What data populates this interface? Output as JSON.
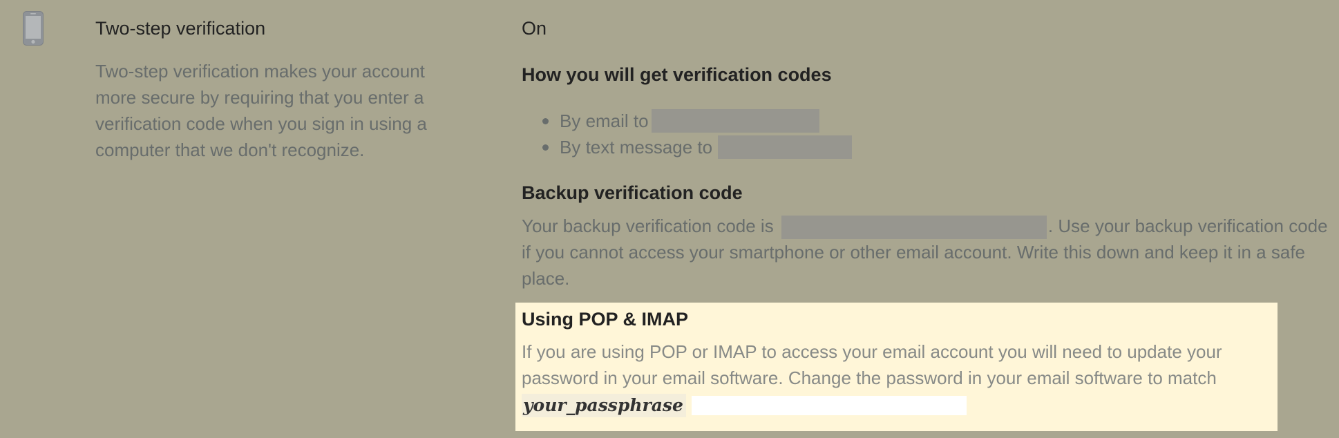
{
  "section": {
    "icon": "smartphone-icon",
    "title": "Two-step verification",
    "description": "Two-step verification makes your account more secure by requiring that you enter a verification code when you sign in using a computer that we don't recognize.",
    "status": "On"
  },
  "methods": {
    "heading": "How you will get verification codes",
    "items": [
      {
        "label": "By email to"
      },
      {
        "label": "By text message to"
      }
    ]
  },
  "backup": {
    "heading": "Backup verification code",
    "text_before": "Your backup verification code is ",
    "text_after": ". Use your backup verification code if you cannot access your smartphone or other email account. Write this down and keep it in a safe place."
  },
  "pop_imap": {
    "heading": "Using POP & IMAP",
    "text": "If you are using POP or IMAP to access your email account you will need to update your password in your email software. Change the password in your email software to match",
    "passphrase_label": "your_passphrase"
  },
  "colors": {
    "background": "#a9a690",
    "highlight_box": "#fff6d8",
    "redaction": "#97968f"
  }
}
